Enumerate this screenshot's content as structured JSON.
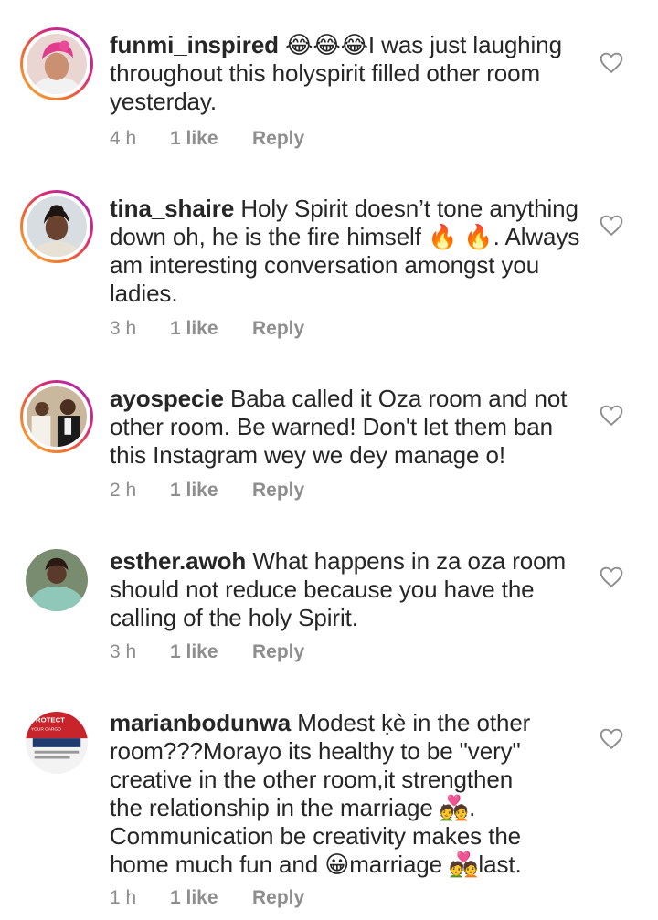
{
  "comments": [
    {
      "username": "funmi_inspired",
      "text": "😂😂😂I was just laughing throughout this holyspirit filled other room yesterday.",
      "lines": [
        "😂😂😂I was just laughing",
        "throughout this holyspirit filled other room",
        "yesterday."
      ],
      "time": "4 h",
      "likes": "1 like",
      "reply": "Reply"
    },
    {
      "username": "tina_shaire",
      "text": "Holy Spirit doesn’t tone anything down oh, he is the fire himself 🔥🔥. Always am interesting conversation amongst you ladies.",
      "lines": [
        "Holy Spirit doesn’t tone anything",
        "down oh, he is the fire himself 🔥 🔥. Always",
        "am interesting conversation amongst you",
        "ladies."
      ],
      "time": "3 h",
      "likes": "1 like",
      "reply": "Reply"
    },
    {
      "username": "ayospecie",
      "text": "Baba called it Oza room and not other room. Be warned! Don't let them ban this Instagram wey we dey manage o!",
      "lines": [
        "Baba called it Oza room and not",
        "other room. Be warned! Don't let them ban",
        "this Instagram wey we dey manage o!"
      ],
      "time": "2 h",
      "likes": "1 like",
      "reply": "Reply"
    },
    {
      "username": "esther.awoh",
      "text": "What happens in za oza room should not reduce because you have the calling of the holy Spirit.",
      "lines": [
        "What happens in za oza room",
        "should not reduce because you have the",
        "calling of the holy Spirit."
      ],
      "time": "3 h",
      "likes": "1 like",
      "reply": "Reply"
    },
    {
      "username": "marianbodunwa",
      "text": "Modest ḳè in the other room???Morayo its healthy to be \"very\" creative in the other room,it strengthen the relationship in the marriage 💑. Communication be creativity makes the home much fun and 😀marriage 💑last.",
      "lines": [
        "Modest ḳè in the other",
        "room???Morayo its healthy to be \"very\"",
        "creative in the other room,it strengthen",
        "the relationship in the marriage 💑.",
        "Communication be creativity makes the",
        "home much fun and 😀marriage 💑last."
      ],
      "time": "1 h",
      "likes": "1 like",
      "reply": "Reply"
    }
  ],
  "avatar_badge": {
    "line1": "PROTECT",
    "line2": "YOUR CARGO"
  },
  "colors": {
    "text": "#262626",
    "meta": "#8e8e8e",
    "ring_start": "#f6b73c",
    "ring_end": "#962fbf"
  },
  "icons": {
    "like": "heart-outline-icon"
  }
}
